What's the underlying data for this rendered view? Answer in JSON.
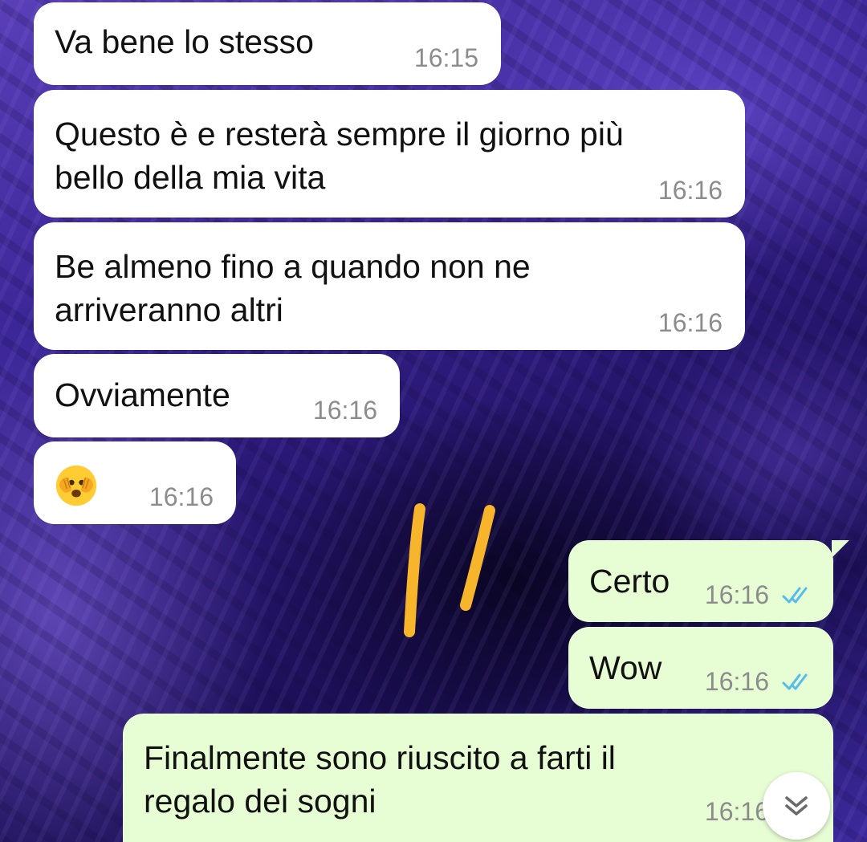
{
  "messages": [
    {
      "direction": "incoming",
      "text": "Va bene lo stesso",
      "time": "16:15"
    },
    {
      "direction": "incoming",
      "text": "Questo è e resterà sempre il giorno più\nbello della mia vita",
      "time": "16:16"
    },
    {
      "direction": "incoming",
      "text": "Be almeno fino a quando non ne\narriveranno altri",
      "time": "16:16"
    },
    {
      "direction": "incoming",
      "text": "Ovviamente",
      "time": "16:16"
    },
    {
      "direction": "incoming",
      "emoji": "face-with-open-eyes-and-hand-over-mouth-emoji",
      "time": "16:16"
    },
    {
      "direction": "outgoing",
      "text": "Certo",
      "time": "16:16",
      "status": "read"
    },
    {
      "direction": "outgoing",
      "text": "Wow",
      "time": "16:16",
      "status": "read"
    },
    {
      "direction": "outgoing",
      "text": "Finalmente sono riuscito a farti il\nregalo dei sogni",
      "time": "16:16"
    }
  ],
  "scroll_button": {
    "icon": "double-chevron-down-icon"
  },
  "colors": {
    "incoming_bubble": "#ffffff",
    "outgoing_bubble": "#e7fdd4",
    "timestamp": "#8c8c8c",
    "read_ticks": "#53bdeb",
    "scribble": "#f7b52c",
    "wallpaper": "#3a2596"
  }
}
